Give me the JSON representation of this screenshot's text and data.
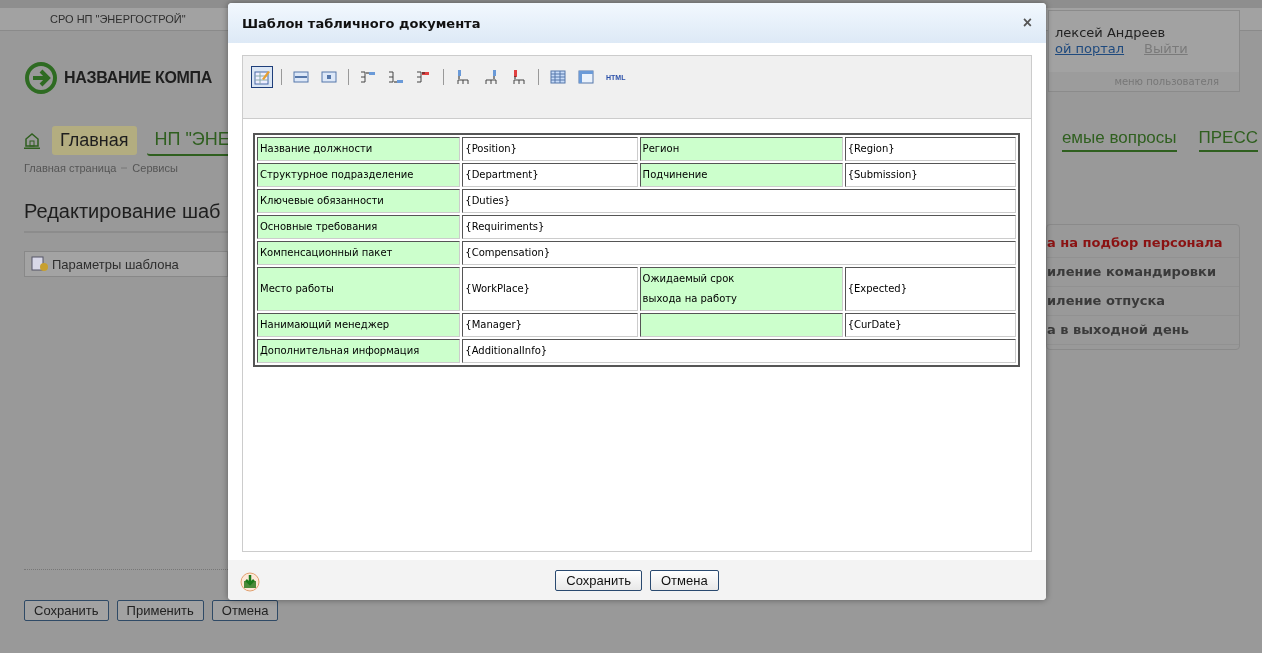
{
  "top_bar": {
    "org_menu": "СРО НП \"ЭНЕРГОСТРОЙ\""
  },
  "logo": {
    "text": "НАЗВАНИЕ КОМПА"
  },
  "user_menu": {
    "name": "лексей Андреев",
    "portal_link": "ой портал",
    "logout_link": "Выйти",
    "footer": "меню пользователя"
  },
  "nav": {
    "items": [
      {
        "label": "Главная",
        "selected": true
      },
      {
        "label": "НП \"ЭНЕ",
        "selected": false
      }
    ],
    "right_items": [
      {
        "label": "емые вопросы"
      },
      {
        "label": "ПРЕСС"
      }
    ]
  },
  "breadcrumbs": [
    "Главная страница",
    "Сервисы"
  ],
  "page_title": "Редактирование шаб",
  "page_toolbar": {
    "button": "Параметры шаблона"
  },
  "services": [
    {
      "label": "а на подбор персонала",
      "selected": true
    },
    {
      "label": "иление командировки",
      "selected": false
    },
    {
      "label": "иление отпуска",
      "selected": false
    },
    {
      "label": "а в выходной день",
      "selected": false
    }
  ],
  "page_buttons": [
    "Сохранить",
    "Применить",
    "Отмена"
  ],
  "dialog": {
    "title": "Шаблон табличного документа",
    "close": "×",
    "tools": [
      {
        "kind": "edit",
        "selected": true
      },
      {
        "kind": "sep"
      },
      {
        "kind": "row",
        "selected": false
      },
      {
        "kind": "cell",
        "selected": false
      },
      {
        "kind": "sep"
      },
      {
        "kind": "row-above",
        "selected": false
      },
      {
        "kind": "row-below",
        "selected": false
      },
      {
        "kind": "row-delete",
        "selected": false
      },
      {
        "kind": "sep"
      },
      {
        "kind": "col-left",
        "selected": false
      },
      {
        "kind": "col-right",
        "selected": false
      },
      {
        "kind": "col-delete",
        "selected": false
      },
      {
        "kind": "sep"
      },
      {
        "kind": "table",
        "selected": false
      },
      {
        "kind": "table-props",
        "selected": false
      },
      {
        "kind": "html",
        "label": "HTML",
        "selected": false
      }
    ],
    "table": {
      "rows": [
        [
          {
            "kind": "label",
            "text": "Название должности"
          },
          {
            "kind": "value",
            "text": "{Position}"
          },
          {
            "kind": "label",
            "text": "Регион"
          },
          {
            "kind": "value",
            "text": "{Region}"
          }
        ],
        [
          {
            "kind": "label",
            "text": "Структурное подразделение"
          },
          {
            "kind": "value",
            "text": "{Department}"
          },
          {
            "kind": "label",
            "text": "Подчинение"
          },
          {
            "kind": "value",
            "text": "{Submission}"
          }
        ],
        [
          {
            "kind": "label",
            "text": "Ключевые обязанности"
          },
          {
            "kind": "value",
            "text": "{Duties}",
            "colspan": 3
          }
        ],
        [
          {
            "kind": "label",
            "text": "Основные требования"
          },
          {
            "kind": "value",
            "text": "{Requiriments}",
            "colspan": 3
          }
        ],
        [
          {
            "kind": "label",
            "text": "Компенсационный пакет"
          },
          {
            "kind": "value",
            "text": "{Compensation}",
            "colspan": 3
          }
        ],
        [
          {
            "kind": "label",
            "text": "Место работы"
          },
          {
            "kind": "value",
            "text": "{WorkPlace}"
          },
          {
            "kind": "label",
            "text": "Ожидаемый срок\nвыхода на работу"
          },
          {
            "kind": "value",
            "text": "{Expected}"
          }
        ],
        [
          {
            "kind": "label",
            "text": "Нанимающий менеджер"
          },
          {
            "kind": "value",
            "text": "{Manager}"
          },
          {
            "kind": "label"
          },
          {
            "kind": "value",
            "text": "{CurDate}"
          }
        ],
        [
          {
            "kind": "label",
            "text": "Дополнительная информация"
          },
          {
            "kind": "value",
            "text": "{AdditionalInfo}",
            "colspan": 3
          }
        ]
      ]
    },
    "buttons": [
      "Сохранить",
      "Отмена"
    ]
  }
}
